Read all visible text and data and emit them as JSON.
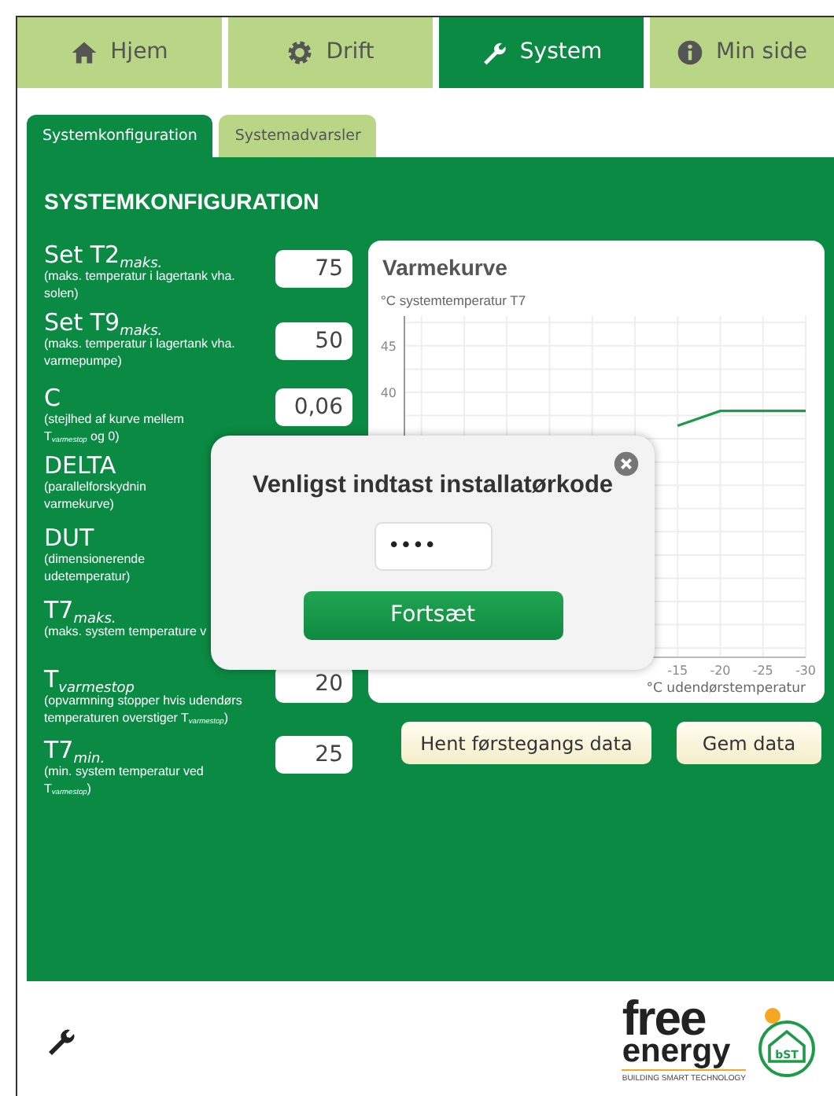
{
  "tabs": [
    {
      "label": "Hjem",
      "selected": false
    },
    {
      "label": "Drift",
      "selected": false
    },
    {
      "label": "System",
      "selected": true
    },
    {
      "label": "Min side",
      "selected": false
    }
  ],
  "subtabs": [
    {
      "label": "Systemkonfiguration",
      "selected": true
    },
    {
      "label": "Systemadvarsler",
      "selected": false
    }
  ],
  "heading": "SYSTEMKONFIGURATION",
  "settings": [
    {
      "kind": "stacked",
      "title": "Set T2$_{maks.}$",
      "note_lines": [
        "(maks. temperatur i lagertank vha.",
        "solen)"
      ],
      "value": "75"
    },
    {
      "kind": "stacked",
      "title": "Set T9$_{maks.}$",
      "note_lines": [
        "(maks. temperatur i lagertank vha.",
        "varmepumpe)"
      ],
      "value": "50"
    },
    {
      "kind": "inline",
      "title": "C",
      "note_lines": [
        "(stejlhed af kurve mellem",
        "T$_{varmestop}$ og 0)"
      ],
      "value": "0,06"
    },
    {
      "kind": "inline",
      "title": "DELTA",
      "note_lines": [
        "(parallelforskydnin",
        "varmekurve)"
      ]
    },
    {
      "kind": "inline",
      "title": "DUT",
      "note_lines": [
        "(dimensionerende",
        "udetemperatur)"
      ]
    },
    {
      "kind": "stacked",
      "title": "T7$_{maks.}$",
      "note_lines": [
        "(maks. system temperature v"
      ]
    },
    {
      "kind": "stacked",
      "title": "T$_{varmestop}$",
      "note_lines": [
        "(opvarmning stopper hvis udendørs",
        "temperaturen overstiger T$_{varmestop}$)"
      ],
      "value": "20"
    },
    {
      "kind": "stacked",
      "title": "T7$_{min.}$",
      "note_lines": [
        "(min. system temperatur ved",
        "T$_{varmestop}$)"
      ],
      "value": "25"
    }
  ],
  "chart": {
    "title": "Varmekurve",
    "chart_data": {
      "type": "line",
      "xlabel": "°C udendørstemperatur",
      "ylabel": "°C systemtemperatur T7",
      "x": [
        -15,
        -20,
        -25,
        -30
      ],
      "series": [
        {
          "color": "#1e9a4a",
          "values": [
            36.4,
            38,
            38,
            38
          ]
        }
      ],
      "grid": true,
      "xlim": [
        17,
        -30
      ],
      "ylim": [
        11.5,
        48.2
      ],
      "xticks": [
        -15,
        -20,
        -25,
        -30
      ],
      "yticks": [
        40,
        45
      ]
    }
  },
  "actions": [
    "Hent førstegangs data",
    "Gem data"
  ],
  "modal": {
    "title": "Venligst indtast installatørkode",
    "value": "••••",
    "button": "Fortsæt"
  },
  "logo": {
    "line1": "free",
    "line2": "energy",
    "badge": "bST",
    "tagline": "BUILDING SMART TECHNOLOGY"
  }
}
